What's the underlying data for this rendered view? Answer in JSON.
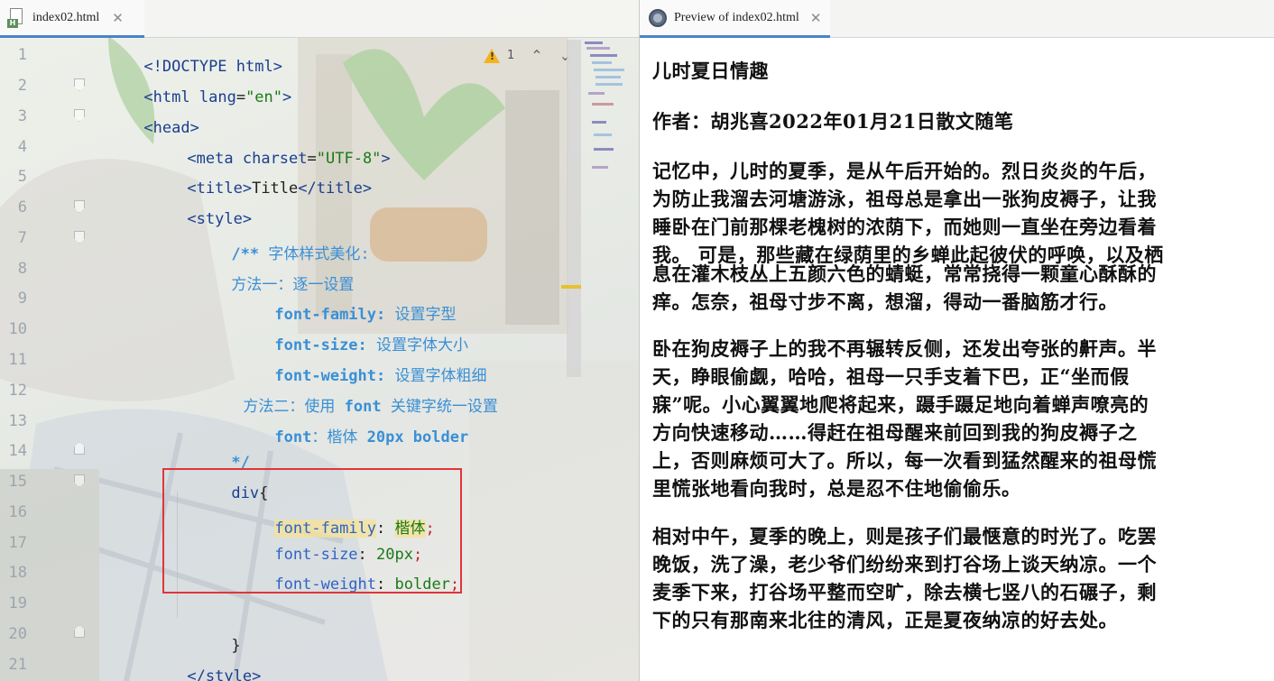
{
  "editor": {
    "tab": {
      "label": "index02.html",
      "icon": "html-file-icon",
      "close": "✕"
    },
    "inspection": {
      "warning_count": "1"
    },
    "line_numbers": [
      "1",
      "2",
      "3",
      "4",
      "5",
      "6",
      "7",
      "8",
      "9",
      "10",
      "11",
      "12",
      "13",
      "14",
      "15",
      "16",
      "17",
      "18",
      "19",
      "20",
      "21"
    ],
    "code": {
      "l1": "<!DOCTYPE html>",
      "l2": {
        "lt": "<",
        "tag": "html",
        "attr": " lang",
        "eq": "=",
        "str": "\"en\"",
        "gt": ">"
      },
      "l3": "<head>",
      "l4": {
        "lt": "<",
        "tag": "meta",
        "attr": " charset",
        "eq": "=",
        "str": "\"UTF-8\"",
        "gt": ">"
      },
      "l5": {
        "open": "<title>",
        "text": "Title",
        "close": "</title>"
      },
      "l6": "<style>",
      "l7": {
        "mark": "/**",
        "text": " 字体样式美化:"
      },
      "l8": "方法一：逐一设置",
      "l9": {
        "key": "font-family:",
        "text": " 设置字型"
      },
      "l10": {
        "key": "font-size:",
        "text": " 设置字体大小"
      },
      "l11": {
        "key": "font-weight:",
        "text": " 设置字体粗细"
      },
      "l12": {
        "a": "方法二：使用 ",
        "key": "font",
        "b": " 关键字统一设置"
      },
      "l13": {
        "key": "font",
        "text": "：楷体 ",
        "rest": "20px bolder"
      },
      "l14": "*/",
      "l15": {
        "sel": "div",
        "brace": "{"
      },
      "l16": {
        "prop": "font-family",
        "colon": ": ",
        "val": "楷体",
        "semi": ";"
      },
      "l17": {
        "prop": "font-size",
        "colon": ": ",
        "val": "20px",
        "semi": ";"
      },
      "l18": {
        "prop": "font-weight",
        "colon": ": ",
        "val": "bolder",
        "semi": ";"
      },
      "l19": "",
      "l20": "}",
      "l21": "</style>"
    }
  },
  "preview": {
    "tab": {
      "label": "Preview of index02.html",
      "icon": "globe-icon",
      "close": "✕"
    },
    "lines": [
      "儿时夏日情趣",
      "作者：胡兆喜2022年01月21日散文随笔",
      "记忆中，儿时的夏季，是从午后开始的。烈日炎炎的午后，",
      "为防止我溜去河塘游泳，祖母总是拿出一张狗皮褥子，让我",
      "睡卧在门前那棵老槐树的浓荫下，而她则一直坐在旁边看着",
      "我。 可是，那些藏在绿荫里的乡蝉此起彼伏的呼唤，以及栖",
      "息在灌木枝丛上五颜六色的蜻蜓，常常挠得一颗童心酥酥的",
      "痒。怎奈，祖母寸步不离，想溜，得动一番脑筋才行。",
      "卧在狗皮褥子上的我不再辗转反侧，还发出夸张的鼾声。半",
      "天，睁眼偷觑，哈哈，祖母一只手支着下巴，正“坐而假",
      "寐”呢。小心翼翼地爬将起来，蹑手蹑足地向着蝉声嘹亮的",
      "方向快速移动……得赶在祖母醒来前回到我的狗皮褥子之",
      "上，否则麻烦可大了。所以，每一次看到猛然醒来的祖母慌",
      "里慌张地看向我时，总是忍不住地偷偷乐。",
      "相对中午，夏季的晚上，则是孩子们最惬意的时光了。吃罢",
      "晚饭，洗了澡，老少爷们纷纷来到打谷场上谈天纳凉。一个",
      "麦季下来，打谷场平整而空旷，除去横七竖八的石碾子，剩",
      "下的只有那南来北往的清风，正是夏夜纳凉的好去处。"
    ]
  }
}
